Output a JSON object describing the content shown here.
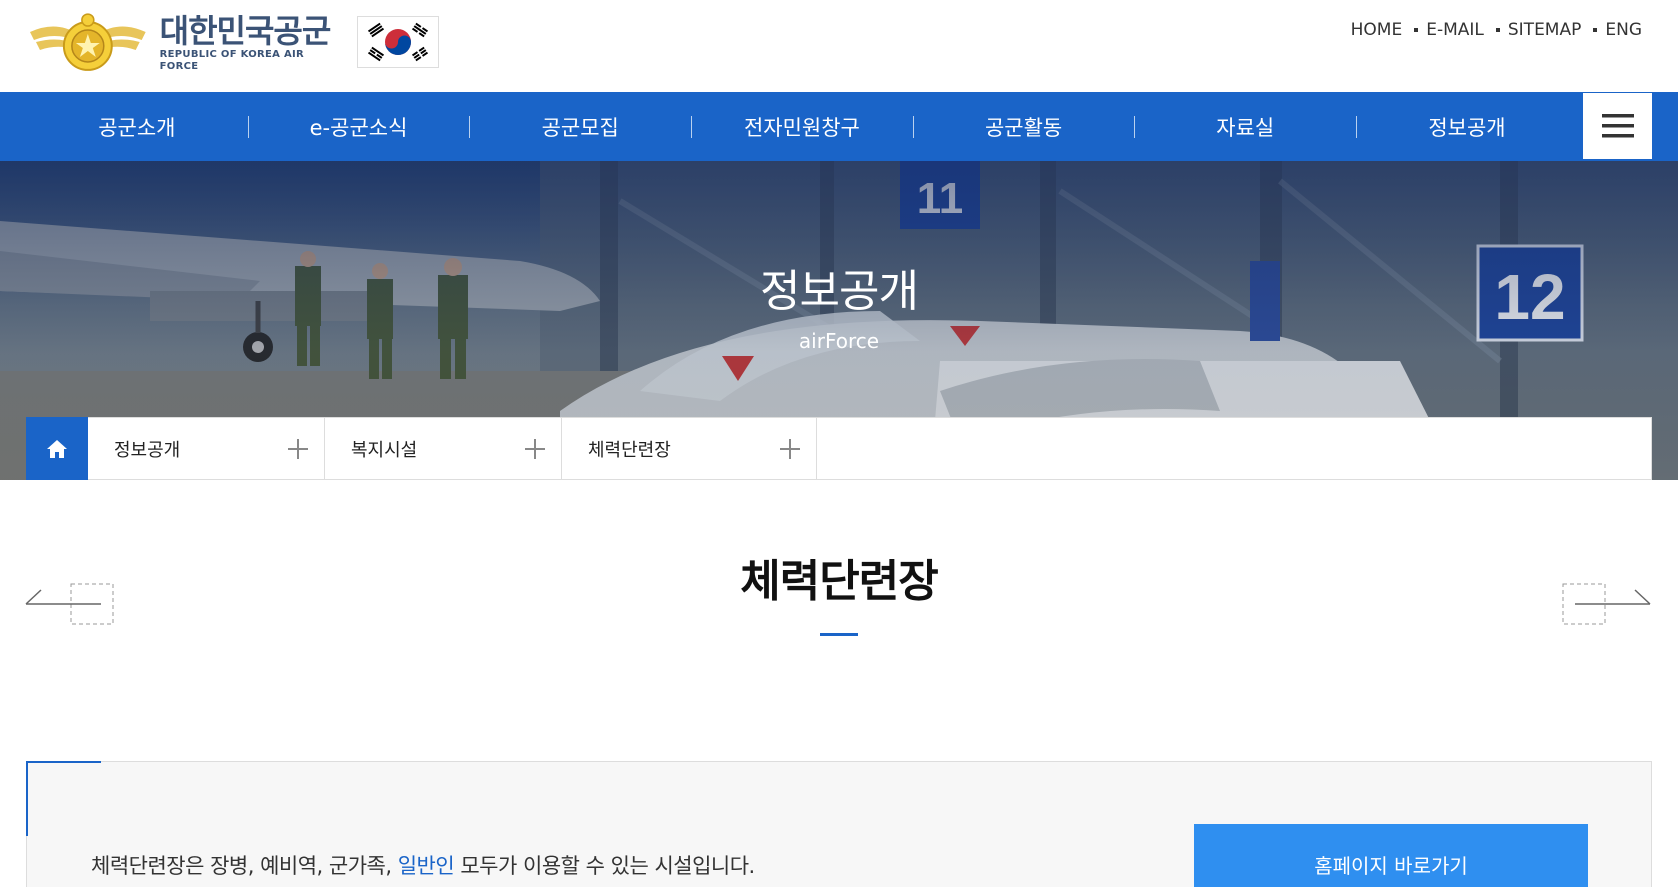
{
  "header": {
    "logo_ko": "대한민국공군",
    "logo_en": "REPUBLIC OF KOREA AIR FORCE",
    "util_links": [
      "HOME",
      "E-MAIL",
      "SITEMAP",
      "ENG"
    ]
  },
  "gnb": {
    "items": [
      "공군소개",
      "e-공군소식",
      "공군모집",
      "전자민원창구",
      "공군활동",
      "자료실",
      "정보공개"
    ],
    "menu_icon": "hamburger-icon"
  },
  "visual": {
    "title": "정보공개",
    "subtitle": "airForce",
    "plane_numbers": [
      "11",
      "12"
    ]
  },
  "breadcrumb": {
    "home_icon": "home-icon",
    "items": [
      "정보공개",
      "복지시설",
      "체력단련장"
    ]
  },
  "page": {
    "title": "체력단련장"
  },
  "info": {
    "text_before": "체력단련장은 장병, 예비역, 군가족, ",
    "text_highlight": "일반인",
    "text_after": " 모두가 이용할 수 있는 시설입니다.",
    "button_label": "홈페이지 바로가기"
  },
  "colors": {
    "primary": "#1a64c8",
    "button": "#2f8ff0",
    "logo_text": "#3b5376"
  }
}
